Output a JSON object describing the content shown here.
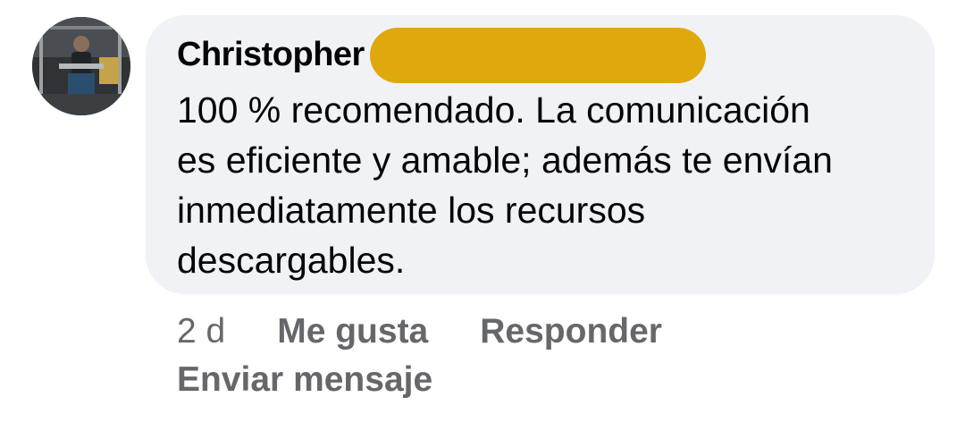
{
  "comment": {
    "author": "Christopher",
    "text": "100 % recomendado. La comunicación\nes eficiente y amable; además te envían\ninmediatamente los recursos\ndescargables.",
    "redaction_color": "#dfa90e"
  },
  "actions": {
    "timestamp": "2 d",
    "like_label": "Me gusta",
    "reply_label": "Responder",
    "send_message_label": "Enviar mensaje"
  },
  "colors": {
    "bubble_background": "#f0f2f5",
    "text": "#050505",
    "secondary_text": "#65676b"
  }
}
